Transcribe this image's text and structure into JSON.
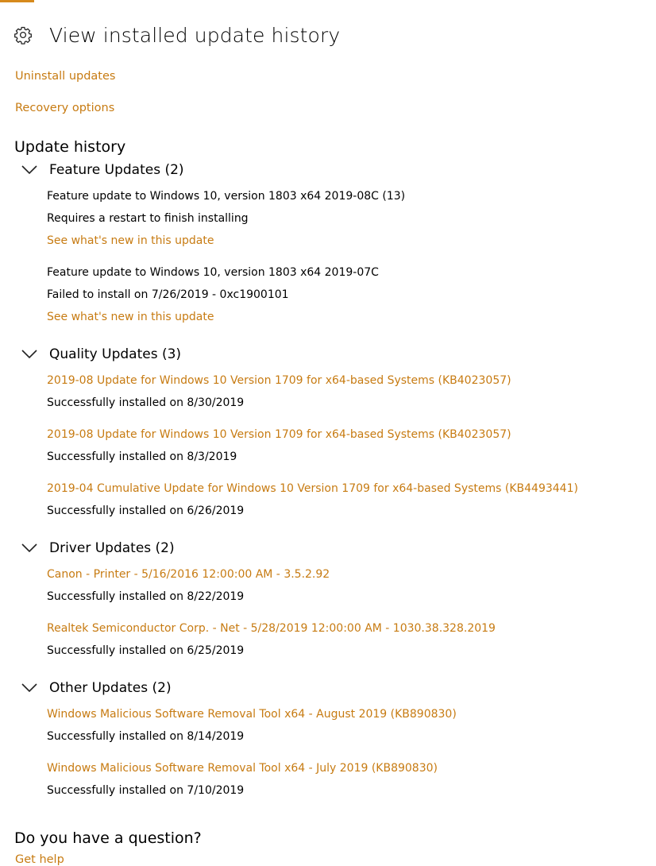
{
  "colors": {
    "accent": "#c77b12",
    "accent_bar": "#d68a1c",
    "text": "#000000"
  },
  "header": {
    "icon": "gear-icon",
    "title": "View installed update history"
  },
  "links": {
    "uninstall": "Uninstall updates",
    "recovery": "Recovery options"
  },
  "history": {
    "title": "Update history",
    "groups": [
      {
        "name": "Feature Updates (2)",
        "items": [
          {
            "title": "Feature update to Windows 10, version 1803 x64 2019-08C (13)",
            "status": "Requires a restart to finish installing",
            "link": "See what's new in this update"
          },
          {
            "title": "Feature update to Windows 10, version 1803 x64 2019-07C",
            "status": "Failed to install on 7/26/2019 - 0xc1900101",
            "link": "See what's new in this update"
          }
        ]
      },
      {
        "name": "Quality Updates (3)",
        "items": [
          {
            "title": "2019-08 Update for Windows 10 Version 1709 for x64-based Systems (KB4023057)",
            "status": "Successfully installed on 8/30/2019"
          },
          {
            "title": "2019-08 Update for Windows 10 Version 1709 for x64-based Systems (KB4023057)",
            "status": "Successfully installed on 8/3/2019"
          },
          {
            "title": "2019-04 Cumulative Update for Windows 10 Version 1709 for x64-based Systems (KB4493441)",
            "status": "Successfully installed on 6/26/2019"
          }
        ]
      },
      {
        "name": "Driver Updates (2)",
        "items": [
          {
            "title": "Canon - Printer - 5/16/2016 12:00:00 AM - 3.5.2.92",
            "status": "Successfully installed on 8/22/2019"
          },
          {
            "title": "Realtek Semiconductor Corp. - Net - 5/28/2019 12:00:00 AM - 1030.38.328.2019",
            "status": "Successfully installed on 6/25/2019"
          }
        ]
      },
      {
        "name": "Other Updates (2)",
        "items": [
          {
            "title": "Windows Malicious Software Removal Tool x64 - August 2019 (KB890830)",
            "status": "Successfully installed on 8/14/2019"
          },
          {
            "title": "Windows Malicious Software Removal Tool x64 - July 2019 (KB890830)",
            "status": "Successfully installed on 7/10/2019"
          }
        ]
      }
    ]
  },
  "question": {
    "title": "Do you have a question?",
    "link": "Get help"
  }
}
